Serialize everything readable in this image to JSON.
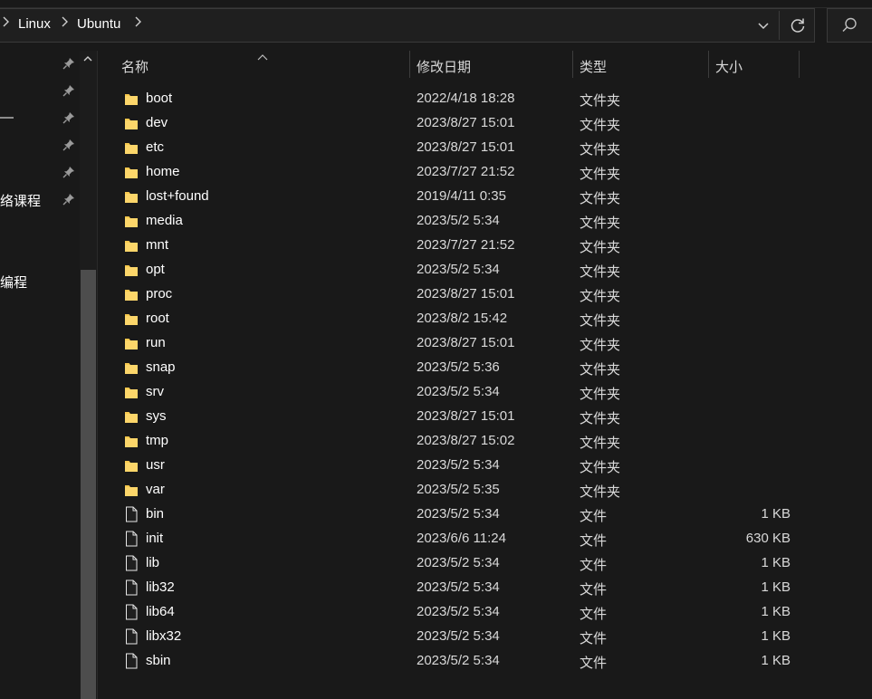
{
  "address_bar": {
    "breadcrumbs": [
      "Linux",
      "Ubuntu"
    ]
  },
  "nav_pane": {
    "items": [
      {
        "label": "",
        "pinned": true
      },
      {
        "label": "",
        "pinned": true
      },
      {
        "label": "—",
        "pinned": true
      },
      {
        "label": "",
        "pinned": true
      },
      {
        "label": "",
        "pinned": true
      },
      {
        "label": "络课程",
        "pinned": true
      },
      {
        "label": "编程",
        "pinned": false
      }
    ]
  },
  "columns": {
    "name": "名称",
    "date": "修改日期",
    "type": "类型",
    "size": "大小"
  },
  "files": [
    {
      "name": "boot",
      "date": "2022/4/18 18:28",
      "type": "文件夹",
      "size": "",
      "icon": "folder-icon"
    },
    {
      "name": "dev",
      "date": "2023/8/27 15:01",
      "type": "文件夹",
      "size": "",
      "icon": "folder-icon"
    },
    {
      "name": "etc",
      "date": "2023/8/27 15:01",
      "type": "文件夹",
      "size": "",
      "icon": "folder-icon"
    },
    {
      "name": "home",
      "date": "2023/7/27 21:52",
      "type": "文件夹",
      "size": "",
      "icon": "folder-icon"
    },
    {
      "name": "lost+found",
      "date": "2019/4/11 0:35",
      "type": "文件夹",
      "size": "",
      "icon": "folder-icon"
    },
    {
      "name": "media",
      "date": "2023/5/2 5:34",
      "type": "文件夹",
      "size": "",
      "icon": "folder-icon"
    },
    {
      "name": "mnt",
      "date": "2023/7/27 21:52",
      "type": "文件夹",
      "size": "",
      "icon": "folder-icon"
    },
    {
      "name": "opt",
      "date": "2023/5/2 5:34",
      "type": "文件夹",
      "size": "",
      "icon": "folder-icon"
    },
    {
      "name": "proc",
      "date": "2023/8/27 15:01",
      "type": "文件夹",
      "size": "",
      "icon": "folder-icon"
    },
    {
      "name": "root",
      "date": "2023/8/2 15:42",
      "type": "文件夹",
      "size": "",
      "icon": "folder-icon"
    },
    {
      "name": "run",
      "date": "2023/8/27 15:01",
      "type": "文件夹",
      "size": "",
      "icon": "folder-icon"
    },
    {
      "name": "snap",
      "date": "2023/5/2 5:36",
      "type": "文件夹",
      "size": "",
      "icon": "folder-icon"
    },
    {
      "name": "srv",
      "date": "2023/5/2 5:34",
      "type": "文件夹",
      "size": "",
      "icon": "folder-icon"
    },
    {
      "name": "sys",
      "date": "2023/8/27 15:01",
      "type": "文件夹",
      "size": "",
      "icon": "folder-icon"
    },
    {
      "name": "tmp",
      "date": "2023/8/27 15:02",
      "type": "文件夹",
      "size": "",
      "icon": "folder-icon"
    },
    {
      "name": "usr",
      "date": "2023/5/2 5:34",
      "type": "文件夹",
      "size": "",
      "icon": "folder-icon"
    },
    {
      "name": "var",
      "date": "2023/5/2 5:35",
      "type": "文件夹",
      "size": "",
      "icon": "folder-icon"
    },
    {
      "name": "bin",
      "date": "2023/5/2 5:34",
      "type": "文件",
      "size": "1 KB",
      "icon": "file-icon"
    },
    {
      "name": "init",
      "date": "2023/6/6 11:24",
      "type": "文件",
      "size": "630 KB",
      "icon": "file-icon"
    },
    {
      "name": "lib",
      "date": "2023/5/2 5:34",
      "type": "文件",
      "size": "1 KB",
      "icon": "file-icon"
    },
    {
      "name": "lib32",
      "date": "2023/5/2 5:34",
      "type": "文件",
      "size": "1 KB",
      "icon": "file-icon"
    },
    {
      "name": "lib64",
      "date": "2023/5/2 5:34",
      "type": "文件",
      "size": "1 KB",
      "icon": "file-icon"
    },
    {
      "name": "libx32",
      "date": "2023/5/2 5:34",
      "type": "文件",
      "size": "1 KB",
      "icon": "file-icon"
    },
    {
      "name": "sbin",
      "date": "2023/5/2 5:34",
      "type": "文件",
      "size": "1 KB",
      "icon": "file-icon"
    }
  ],
  "colors": {
    "background": "#191919",
    "folder": "#f8c94e",
    "text": "#ffffff",
    "secondary_text": "#d9d9d9"
  }
}
